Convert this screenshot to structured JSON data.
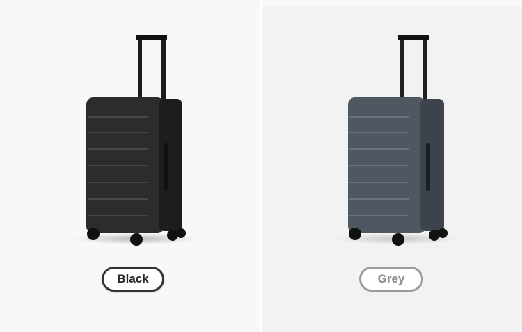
{
  "options": [
    {
      "label": "Black",
      "color": "#2b2b2b",
      "selected": true
    },
    {
      "label": "Grey",
      "color": "#4f5761",
      "selected": false
    }
  ],
  "icons": {
    "product": "suitcase-icon"
  }
}
